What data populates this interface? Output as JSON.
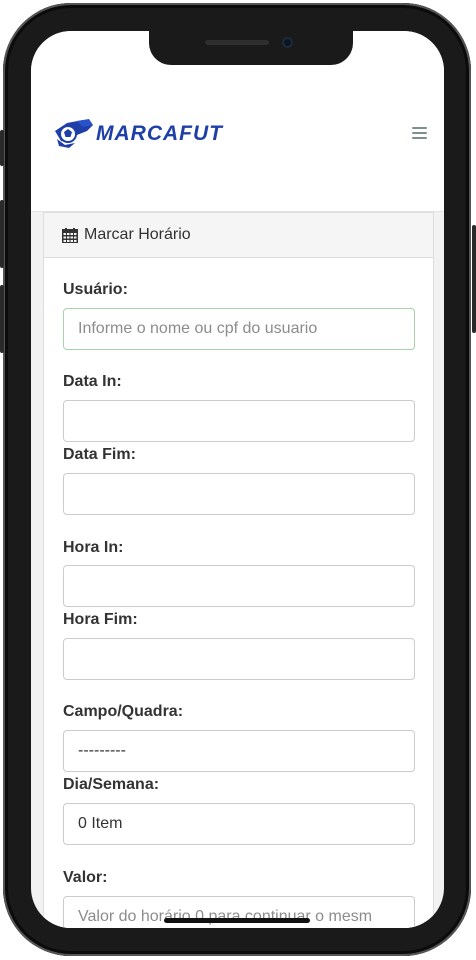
{
  "app": {
    "brand_name": "MARCAFUT",
    "brand_color": "#1f3fa8"
  },
  "panel": {
    "title": "Marcar Horário",
    "title_icon": "calendar-icon"
  },
  "form": {
    "usuario": {
      "label": "Usuário:",
      "placeholder": "Informe o nome ou cpf do usuario",
      "value": ""
    },
    "data_in": {
      "label": "Data In:",
      "value": ""
    },
    "data_fim": {
      "label": "Data Fim:",
      "value": ""
    },
    "hora_in": {
      "label": "Hora In:",
      "value": ""
    },
    "hora_fim": {
      "label": "Hora Fim:",
      "value": ""
    },
    "campo_quadra": {
      "label": "Campo/Quadra:",
      "selected": "---------"
    },
    "dia_semana": {
      "label": "Dia/Semana:",
      "selected": "0 Item"
    },
    "valor": {
      "label": "Valor:",
      "placeholder": "Valor do horário,0 para continuar o mesm",
      "value": ""
    }
  }
}
